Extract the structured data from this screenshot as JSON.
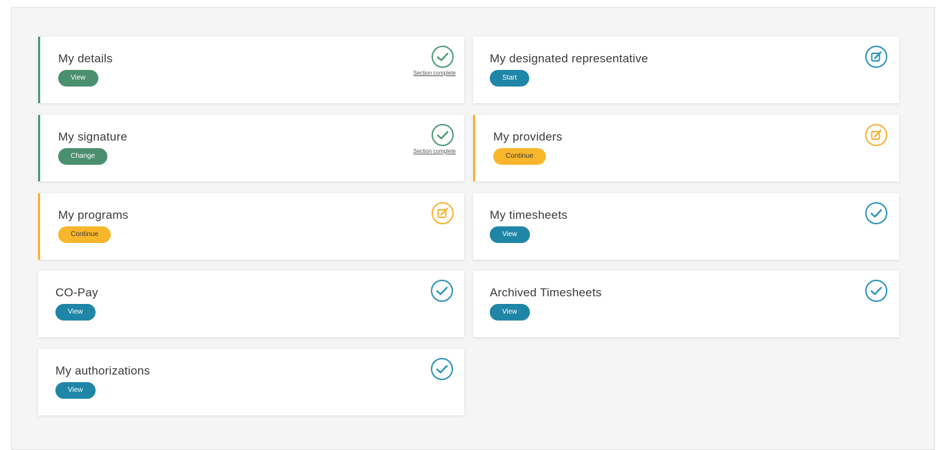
{
  "colors": {
    "green": "#4a8f6e",
    "blue": "#1f86a8",
    "orange": "#f9b62b",
    "complete_check": "#4e9a76",
    "info_check": "#2a93b8"
  },
  "cards": [
    {
      "title": "My details",
      "button": "View",
      "status_icon": "check-circle-icon",
      "status_text": "Section complete"
    },
    {
      "title": "My designated representative",
      "button": "Start",
      "status_icon": "edit-icon"
    },
    {
      "title": "My signature",
      "button": "Change",
      "status_icon": "check-circle-icon",
      "status_text": "Section complete"
    },
    {
      "title": "My providers",
      "button": "Continue",
      "status_icon": "edit-icon"
    },
    {
      "title": "My programs",
      "button": "Continue",
      "status_icon": "edit-icon"
    },
    {
      "title": "My timesheets",
      "button": "View",
      "status_icon": "check-circle-icon"
    },
    {
      "title": "CO-Pay",
      "button": "View",
      "status_icon": "check-circle-icon"
    },
    {
      "title": "Archived Timesheets",
      "button": "View",
      "status_icon": "check-circle-icon"
    },
    {
      "title": "My authorizations",
      "button": "View",
      "status_icon": "check-circle-icon"
    }
  ]
}
